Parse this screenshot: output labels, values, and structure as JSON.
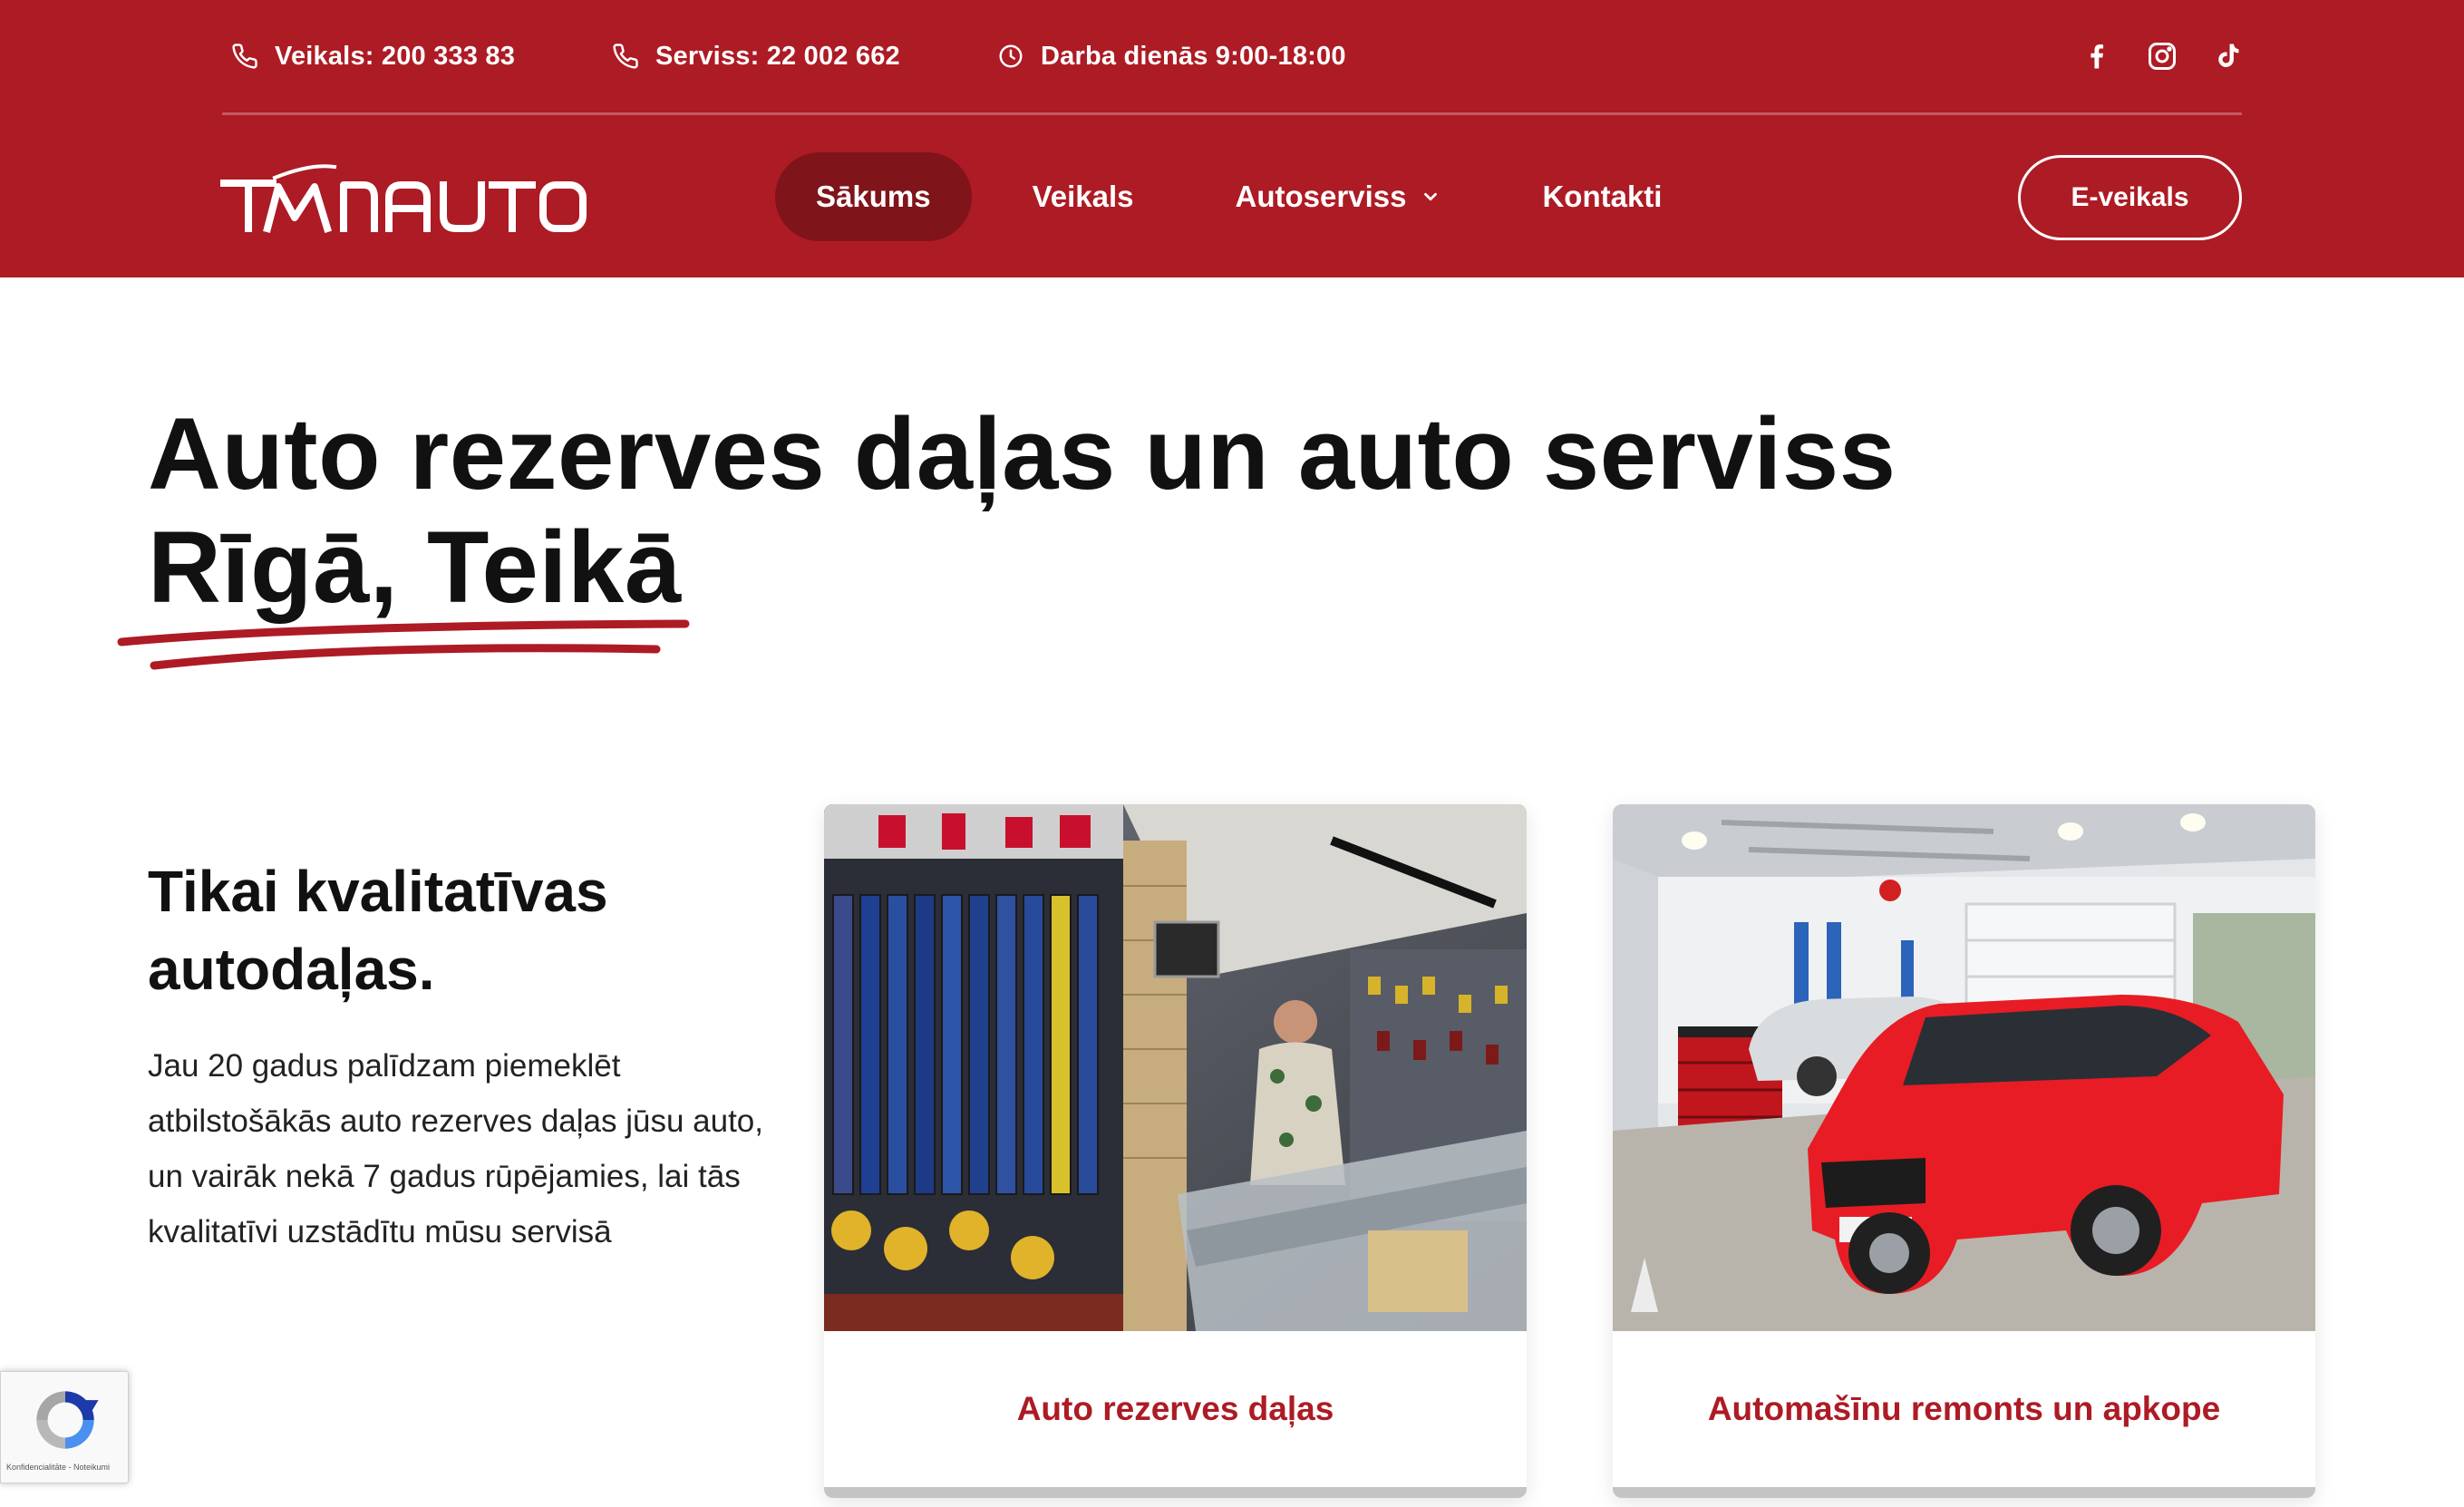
{
  "topbar": {
    "shop_phone": "Veikals: 200 333 83",
    "service_phone": "Serviss: 22 002 662",
    "hours": "Darba dienās 9:00-18:00",
    "icons": [
      "phone-icon",
      "phone-icon",
      "clock-icon",
      "facebook-icon",
      "instagram-icon",
      "tiktok-icon"
    ]
  },
  "logo": {
    "text": "TMNAUTO"
  },
  "nav": {
    "items": [
      {
        "label": "Sākums",
        "active": true
      },
      {
        "label": "Veikals"
      },
      {
        "label": "Autoserviss",
        "has_dropdown": true
      },
      {
        "label": "Kontakti"
      }
    ],
    "cta_label": "E-veikals"
  },
  "hero": {
    "title_line1": "Auto rezerves daļas un auto serviss",
    "title_line2": "Rīgā, Teikā"
  },
  "intro": {
    "title": "Tikai kvalitatīvas autodaļas.",
    "text": "Jau 20 gadus palīdzam piemeklēt atbilstošākās auto rezerves daļas jūsu auto, un vairāk nekā 7 gadus rūpējamies, lai tās kvalitatīvi uzstādītu mūsu servisā"
  },
  "cards": [
    {
      "label": "Auto rezerves daļas",
      "image": "auto-parts-shop-photo"
    },
    {
      "label": "Automašīnu remonts un apkope",
      "image": "car-service-garage-photo"
    }
  ],
  "recaptcha": {
    "text": "Konfidencialitāte - Noteikumi"
  },
  "colors": {
    "brand_red": "#ad1b24",
    "nav_active": "#7f141a",
    "text_dark": "#111111",
    "card_border": "#c4c4c4"
  }
}
